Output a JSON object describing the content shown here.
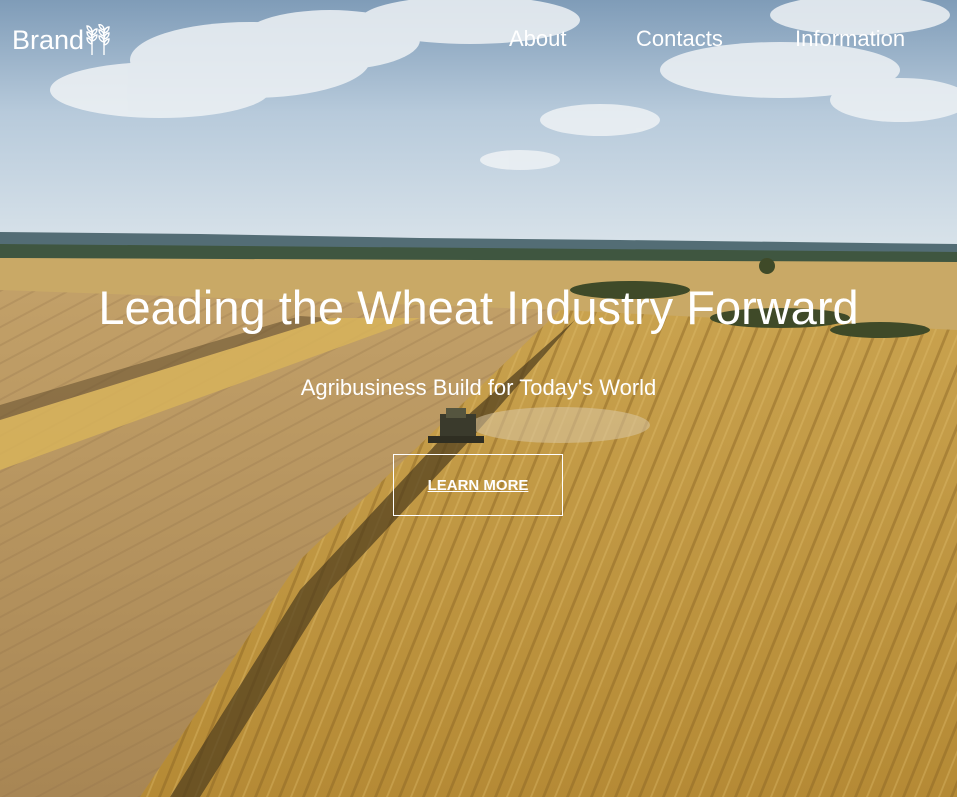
{
  "navbar": {
    "brand": "Brand",
    "brand_icon": "wheat-icon",
    "links": [
      {
        "label": "About"
      },
      {
        "label": "Contacts"
      },
      {
        "label": "Information"
      }
    ]
  },
  "hero": {
    "background": "aerial-wheat-field-harvest-photo",
    "headline": "Leading the Wheat Industry Forward",
    "subheadline": "Agribusiness Build for Today's World",
    "cta_label": "LEARN MORE"
  },
  "colors": {
    "text": "#ffffff",
    "sky": "#c8d8e6",
    "field": "#b89448",
    "wheat_rows": "#d2aa50"
  }
}
